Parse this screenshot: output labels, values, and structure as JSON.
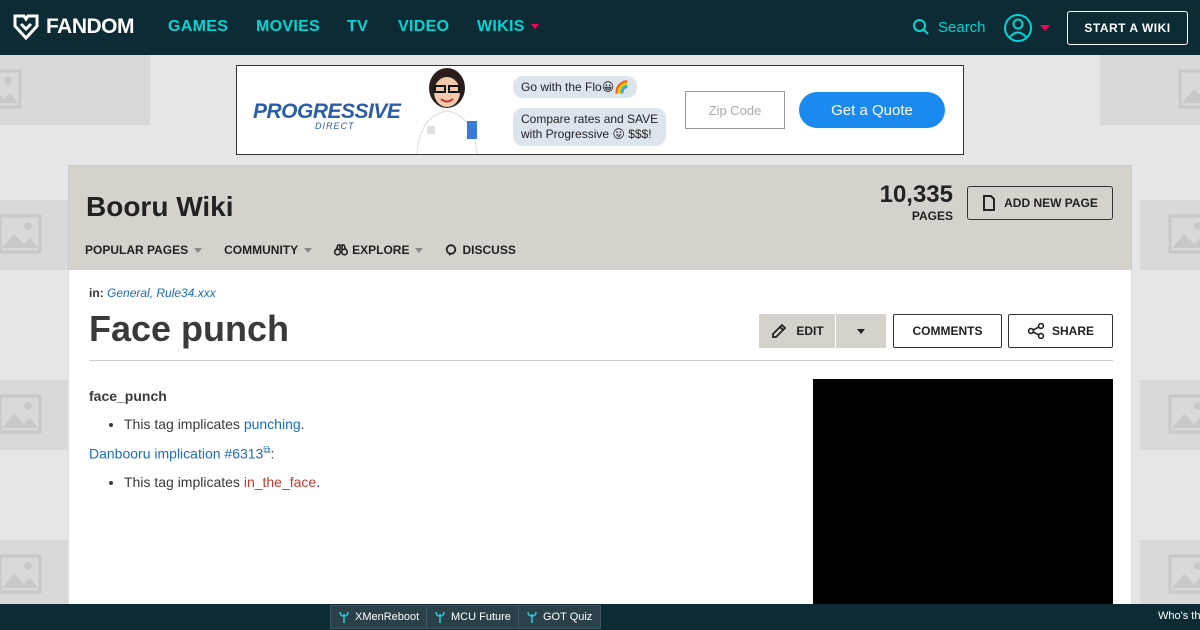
{
  "topnav": {
    "logo_text": "FANDOM",
    "links": [
      {
        "label": "GAMES"
      },
      {
        "label": "MOVIES"
      },
      {
        "label": "TV"
      },
      {
        "label": "VIDEO"
      },
      {
        "label": "WIKIS"
      }
    ],
    "search_label": "Search",
    "start_wiki_label": "START A WIKI",
    "accent_color": "#00d6d6",
    "caret_color": "#fa005a",
    "bar_color": "#0c2b34"
  },
  "ad": {
    "brand": "PROGRESSIVE",
    "brand_sub": "DIRECT",
    "bubble_1": "Go with the Flo😀🌈",
    "bubble_2_line1": "Compare rates and SAVE",
    "bubble_2_line2": "with Progressive 😛 $$$!",
    "zip_placeholder": "Zip Code",
    "cta": "Get a Quote"
  },
  "wiki": {
    "title": "Booru Wiki",
    "page_count": "10,335",
    "page_count_label": "PAGES",
    "add_page_label": "ADD NEW PAGE",
    "nav": {
      "popular": "POPULAR PAGES",
      "community": "COMMUNITY",
      "explore": "EXPLORE",
      "discuss": "DISCUSS"
    }
  },
  "article": {
    "categories_prefix": "in:",
    "categories": "General, Rule34.xxx",
    "title": "Face punch",
    "edit_label": "EDIT",
    "comments_label": "COMMENTS",
    "share_label": "SHARE",
    "tag_name": "face_punch",
    "item1_text": "This tag implicates ",
    "item1_link": "punching",
    "implication_link": "Danbooru implication #6313",
    "item2_text": "This tag implicates ",
    "item2_link": "in_the_face"
  },
  "bottombar": {
    "items": [
      {
        "label": "XMenReboot"
      },
      {
        "label": "MCU Future"
      },
      {
        "label": "GOT Quiz"
      }
    ],
    "right_text": "Who's th"
  }
}
